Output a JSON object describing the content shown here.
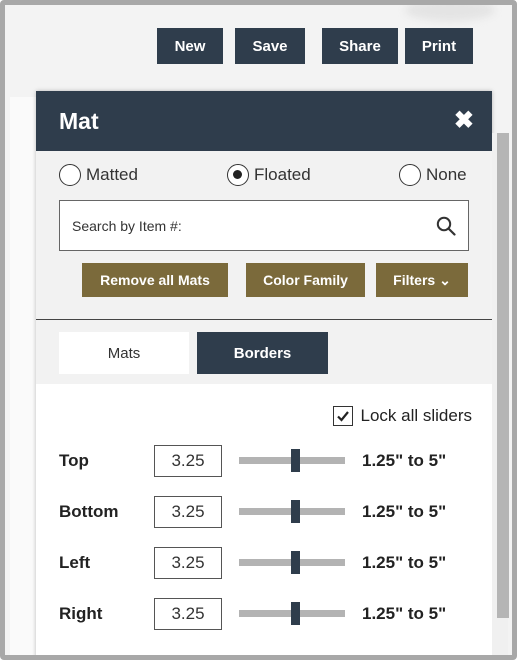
{
  "toolbar": {
    "buttons": [
      "New",
      "Save",
      "Share",
      "Print"
    ]
  },
  "panel": {
    "title": "Mat",
    "close_icon": "close-icon",
    "mat_type": {
      "options": [
        "Matted",
        "Floated",
        "None"
      ],
      "selected": "Floated"
    },
    "search": {
      "placeholder": "Search by Item #:",
      "value": "",
      "icon": "search-icon"
    },
    "actions": [
      "Remove all Mats",
      "Color Family",
      "Filters ⌄"
    ],
    "tabs": {
      "items": [
        "Mats",
        "Borders"
      ],
      "active": "Borders"
    },
    "borders": {
      "lock_all_sliders": {
        "label": "Lock all sliders",
        "checked": true
      },
      "sliders": [
        {
          "label": "Top",
          "value": "3.25",
          "range": "1.25\" to 5\"",
          "min": 1.25,
          "max": 5
        },
        {
          "label": "Bottom",
          "value": "3.25",
          "range": "1.25\" to 5\"",
          "min": 1.25,
          "max": 5
        },
        {
          "label": "Left",
          "value": "3.25",
          "range": "1.25\" to 5\"",
          "min": 1.25,
          "max": 5
        },
        {
          "label": "Right",
          "value": "3.25",
          "range": "1.25\" to 5\"",
          "min": 1.25,
          "max": 5
        }
      ]
    }
  },
  "colors": {
    "navy": "#2f3d4c",
    "olive": "#7b6a3b",
    "track": "#b3b3b3"
  }
}
